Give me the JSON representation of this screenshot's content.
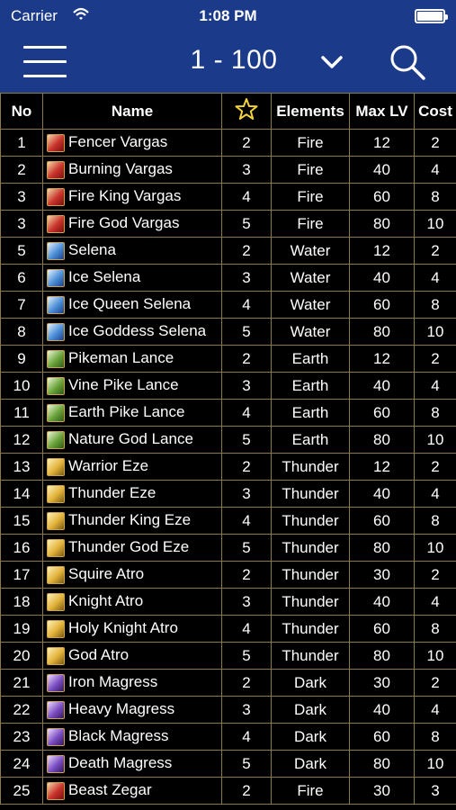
{
  "status_bar": {
    "carrier": "Carrier",
    "time": "1:08 PM"
  },
  "nav": {
    "range_label": "1 - 100"
  },
  "table": {
    "headers": {
      "no": "No",
      "name": "Name",
      "elements": "Elements",
      "max_lv": "Max LV",
      "cost": "Cost"
    },
    "rows": [
      {
        "no": "1",
        "name": "Fencer Vargas",
        "rarity": "2",
        "element": "Fire",
        "max_lv": "12",
        "cost": "2"
      },
      {
        "no": "2",
        "name": "Burning Vargas",
        "rarity": "3",
        "element": "Fire",
        "max_lv": "40",
        "cost": "4"
      },
      {
        "no": "3",
        "name": "Fire King Vargas",
        "rarity": "4",
        "element": "Fire",
        "max_lv": "60",
        "cost": "8"
      },
      {
        "no": "3",
        "name": "Fire God Vargas",
        "rarity": "5",
        "element": "Fire",
        "max_lv": "80",
        "cost": "10"
      },
      {
        "no": "5",
        "name": "Selena",
        "rarity": "2",
        "element": "Water",
        "max_lv": "12",
        "cost": "2"
      },
      {
        "no": "6",
        "name": "Ice Selena",
        "rarity": "3",
        "element": "Water",
        "max_lv": "40",
        "cost": "4"
      },
      {
        "no": "7",
        "name": "Ice Queen Selena",
        "rarity": "4",
        "element": "Water",
        "max_lv": "60",
        "cost": "8"
      },
      {
        "no": "8",
        "name": "Ice Goddess Selena",
        "rarity": "5",
        "element": "Water",
        "max_lv": "80",
        "cost": "10"
      },
      {
        "no": "9",
        "name": "Pikeman Lance",
        "rarity": "2",
        "element": "Earth",
        "max_lv": "12",
        "cost": "2"
      },
      {
        "no": "10",
        "name": "Vine Pike Lance",
        "rarity": "3",
        "element": "Earth",
        "max_lv": "40",
        "cost": "4"
      },
      {
        "no": "11",
        "name": "Earth Pike Lance",
        "rarity": "4",
        "element": "Earth",
        "max_lv": "60",
        "cost": "8"
      },
      {
        "no": "12",
        "name": "Nature God Lance",
        "rarity": "5",
        "element": "Earth",
        "max_lv": "80",
        "cost": "10"
      },
      {
        "no": "13",
        "name": "Warrior Eze",
        "rarity": "2",
        "element": "Thunder",
        "max_lv": "12",
        "cost": "2"
      },
      {
        "no": "14",
        "name": "Thunder Eze",
        "rarity": "3",
        "element": "Thunder",
        "max_lv": "40",
        "cost": "4"
      },
      {
        "no": "15",
        "name": "Thunder King Eze",
        "rarity": "4",
        "element": "Thunder",
        "max_lv": "60",
        "cost": "8"
      },
      {
        "no": "16",
        "name": "Thunder God Eze",
        "rarity": "5",
        "element": "Thunder",
        "max_lv": "80",
        "cost": "10"
      },
      {
        "no": "17",
        "name": "Squire Atro",
        "rarity": "2",
        "element": "Thunder",
        "max_lv": "30",
        "cost": "2"
      },
      {
        "no": "18",
        "name": "Knight Atro",
        "rarity": "3",
        "element": "Thunder",
        "max_lv": "40",
        "cost": "4"
      },
      {
        "no": "19",
        "name": "Holy Knight Atro",
        "rarity": "4",
        "element": "Thunder",
        "max_lv": "60",
        "cost": "8"
      },
      {
        "no": "20",
        "name": "God Atro",
        "rarity": "5",
        "element": "Thunder",
        "max_lv": "80",
        "cost": "10"
      },
      {
        "no": "21",
        "name": "Iron Magress",
        "rarity": "2",
        "element": "Dark",
        "max_lv": "30",
        "cost": "2"
      },
      {
        "no": "22",
        "name": "Heavy Magress",
        "rarity": "3",
        "element": "Dark",
        "max_lv": "40",
        "cost": "4"
      },
      {
        "no": "23",
        "name": "Black Magress",
        "rarity": "4",
        "element": "Dark",
        "max_lv": "60",
        "cost": "8"
      },
      {
        "no": "24",
        "name": "Death Magress",
        "rarity": "5",
        "element": "Dark",
        "max_lv": "80",
        "cost": "10"
      },
      {
        "no": "25",
        "name": "Beast Zegar",
        "rarity": "2",
        "element": "Fire",
        "max_lv": "30",
        "cost": "3"
      }
    ]
  },
  "colors": {
    "header_bg": "#1b3a8a",
    "grid_line": "#8a7a4a",
    "star": "#f3d23a"
  }
}
